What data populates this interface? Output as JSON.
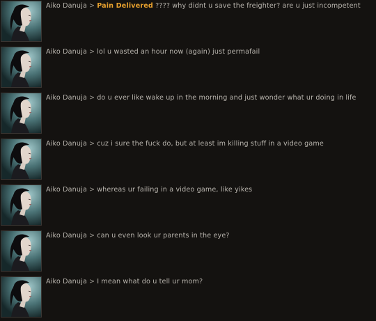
{
  "chat": {
    "separator": ">",
    "messages": [
      {
        "sender": "Aiko Danuja",
        "mention": "Pain Delivered",
        "text": " ???? why didnt u save the freighter? are u just incompetent"
      },
      {
        "sender": "Aiko Danuja",
        "mention": "",
        "text": "lol u wasted an hour now (again) just permafail"
      },
      {
        "sender": "Aiko Danuja",
        "mention": "",
        "text": "do u ever like wake up in the morning and just wonder what ur doing in life"
      },
      {
        "sender": "Aiko Danuja",
        "mention": "",
        "text": "cuz i sure the fuck do, but at least im killing stuff in a video game"
      },
      {
        "sender": "Aiko Danuja",
        "mention": "",
        "text": "whereas ur failing in a video game, like yikes"
      },
      {
        "sender": "Aiko Danuja",
        "mention": "",
        "text": "can u even look ur parents in the eye?"
      },
      {
        "sender": "Aiko Danuja",
        "mention": "",
        "text": "I mean what do u tell ur mom?"
      }
    ]
  },
  "colors": {
    "background": "#141210",
    "text": "#b9b5ae",
    "mention": "#e8a12e"
  },
  "icons": {
    "avatar": "character-portrait-icon"
  }
}
